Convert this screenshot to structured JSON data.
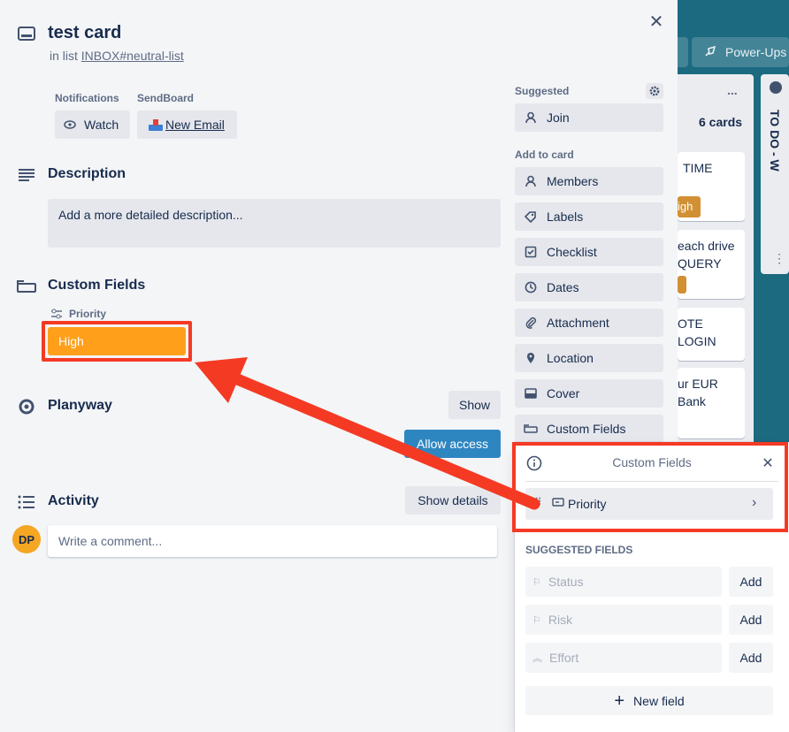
{
  "board": {
    "powerups_label": "Power-Ups",
    "list_menu": "...",
    "list_count": "6 cards",
    "partial_list_title": "TO DO - W",
    "cards": [
      {
        "text": "TIME",
        "badge": "igh"
      },
      {
        "text": "each drive\nQUERY"
      },
      {
        "text": "OTE LOGIN"
      },
      {
        "text": "ur EUR\nBank"
      }
    ]
  },
  "card": {
    "title": "test card",
    "in_list_prefix": "in list",
    "list_name": "INBOX#neutral-list",
    "close_symbol": "✕"
  },
  "notifications": {
    "label": "Notifications",
    "watch": "Watch"
  },
  "sendboard": {
    "label": "SendBoard",
    "new_email": "New Email"
  },
  "description": {
    "title": "Description",
    "placeholder": "Add a more detailed description..."
  },
  "custom_fields": {
    "title": "Custom Fields",
    "priority_label": "Priority",
    "priority_value": "High",
    "priority_color": "#ff9f1a"
  },
  "planyway": {
    "title": "Planyway",
    "show": "Show",
    "allow_access": "Allow access"
  },
  "activity": {
    "title": "Activity",
    "show_details": "Show details",
    "avatar_initials": "DP",
    "comment_placeholder": "Write a comment..."
  },
  "sidebar": {
    "suggested_label": "Suggested",
    "join": "Join",
    "add_to_card_label": "Add to card",
    "items": [
      {
        "label": "Members",
        "icon": "member-icon"
      },
      {
        "label": "Labels",
        "icon": "label-icon"
      },
      {
        "label": "Checklist",
        "icon": "checklist-icon"
      },
      {
        "label": "Dates",
        "icon": "clock-icon"
      },
      {
        "label": "Attachment",
        "icon": "paperclip-icon"
      },
      {
        "label": "Location",
        "icon": "location-pin-icon"
      },
      {
        "label": "Cover",
        "icon": "cover-icon"
      },
      {
        "label": "Custom Fields",
        "icon": "custom-fields-icon"
      }
    ]
  },
  "popover": {
    "title": "Custom Fields",
    "existing_field": "Priority",
    "suggested_label": "SUGGESTED FIELDS",
    "suggested": [
      {
        "label": "Status",
        "add": "Add"
      },
      {
        "label": "Risk",
        "add": "Add"
      },
      {
        "label": "Effort",
        "add": "Add"
      }
    ],
    "new_field": "New field"
  },
  "colors": {
    "highlight_red": "#f53a24",
    "accent_blue": "#0079bf",
    "avatar": "#f5a623"
  }
}
